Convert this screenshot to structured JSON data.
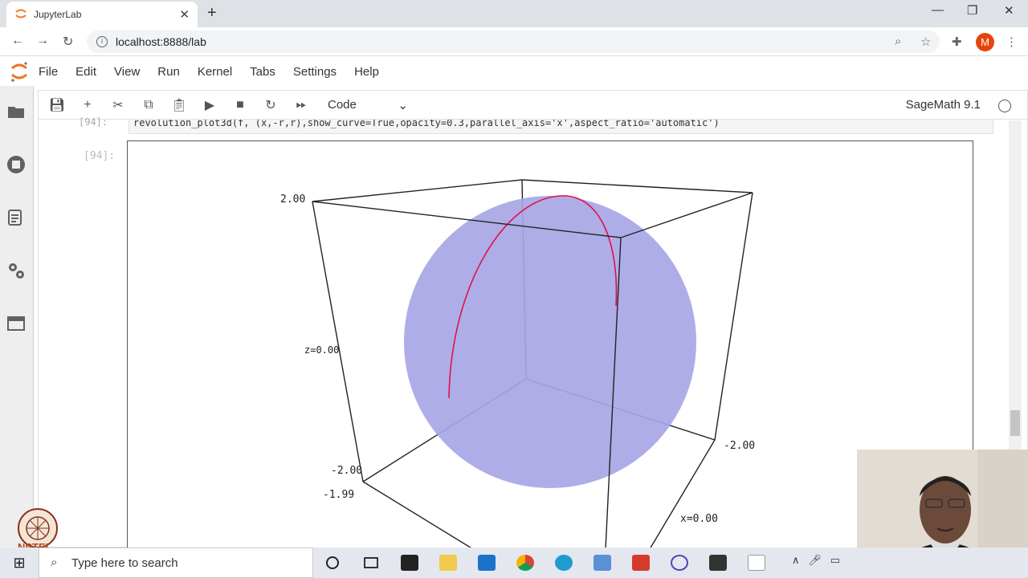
{
  "browser": {
    "tab_title": "JupyterLab",
    "new_tab_icon": "+",
    "close_tab_icon": "✕",
    "url": "localhost:8888/lab",
    "profile_initial": "M"
  },
  "menu": [
    "File",
    "Edit",
    "View",
    "Run",
    "Kernel",
    "Tabs",
    "Settings",
    "Help"
  ],
  "toolbar": {
    "cell_type": "Code",
    "kernel_name": "SageMath 9.1"
  },
  "cell": {
    "input_prompt": "[94]:",
    "output_prompt": "[94]:",
    "code": "revolution_plot3d(f, (x,-r,r),show_curve=True,opacity=0.3,parallel_axis='x',aspect_ratio='automatic')"
  },
  "plot": {
    "label_top_left": "2.00",
    "label_z": "z=0.00",
    "label_bottom_left": "-2.00",
    "label_bottom_left2": "-1.99",
    "label_right": "-2.00",
    "label_x": "x=0.00",
    "sphere_color": "#a7a6e6",
    "curve_color": "#e0114a"
  },
  "taskbar": {
    "search_placeholder": "Type here to search"
  },
  "watermark": "NPTEL"
}
